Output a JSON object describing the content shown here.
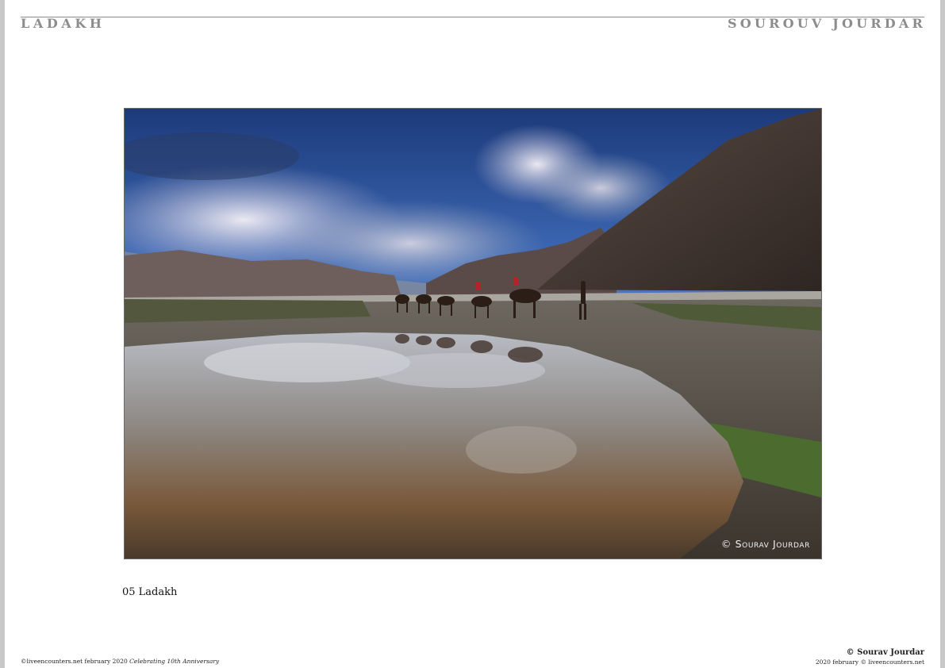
{
  "header": {
    "left": "LADAKH",
    "right": "SOUROUV JOURDAR"
  },
  "photo": {
    "watermark": "© Sourav Jourdar",
    "subject_icon": "landscape-photo"
  },
  "caption": "05 Ladakh",
  "footer": {
    "left_prefix": "©liveencounters.net february 2020",
    "left_italic": "Celebrating 10th Anniversary",
    "right_credit": "© Sourav Jourdar",
    "right_sub": "2020 february © liveencounters.net"
  },
  "colors": {
    "header_text": "#8c8c8c",
    "page_bg": "#ffffff",
    "margin_bg": "#c8c8c8"
  }
}
